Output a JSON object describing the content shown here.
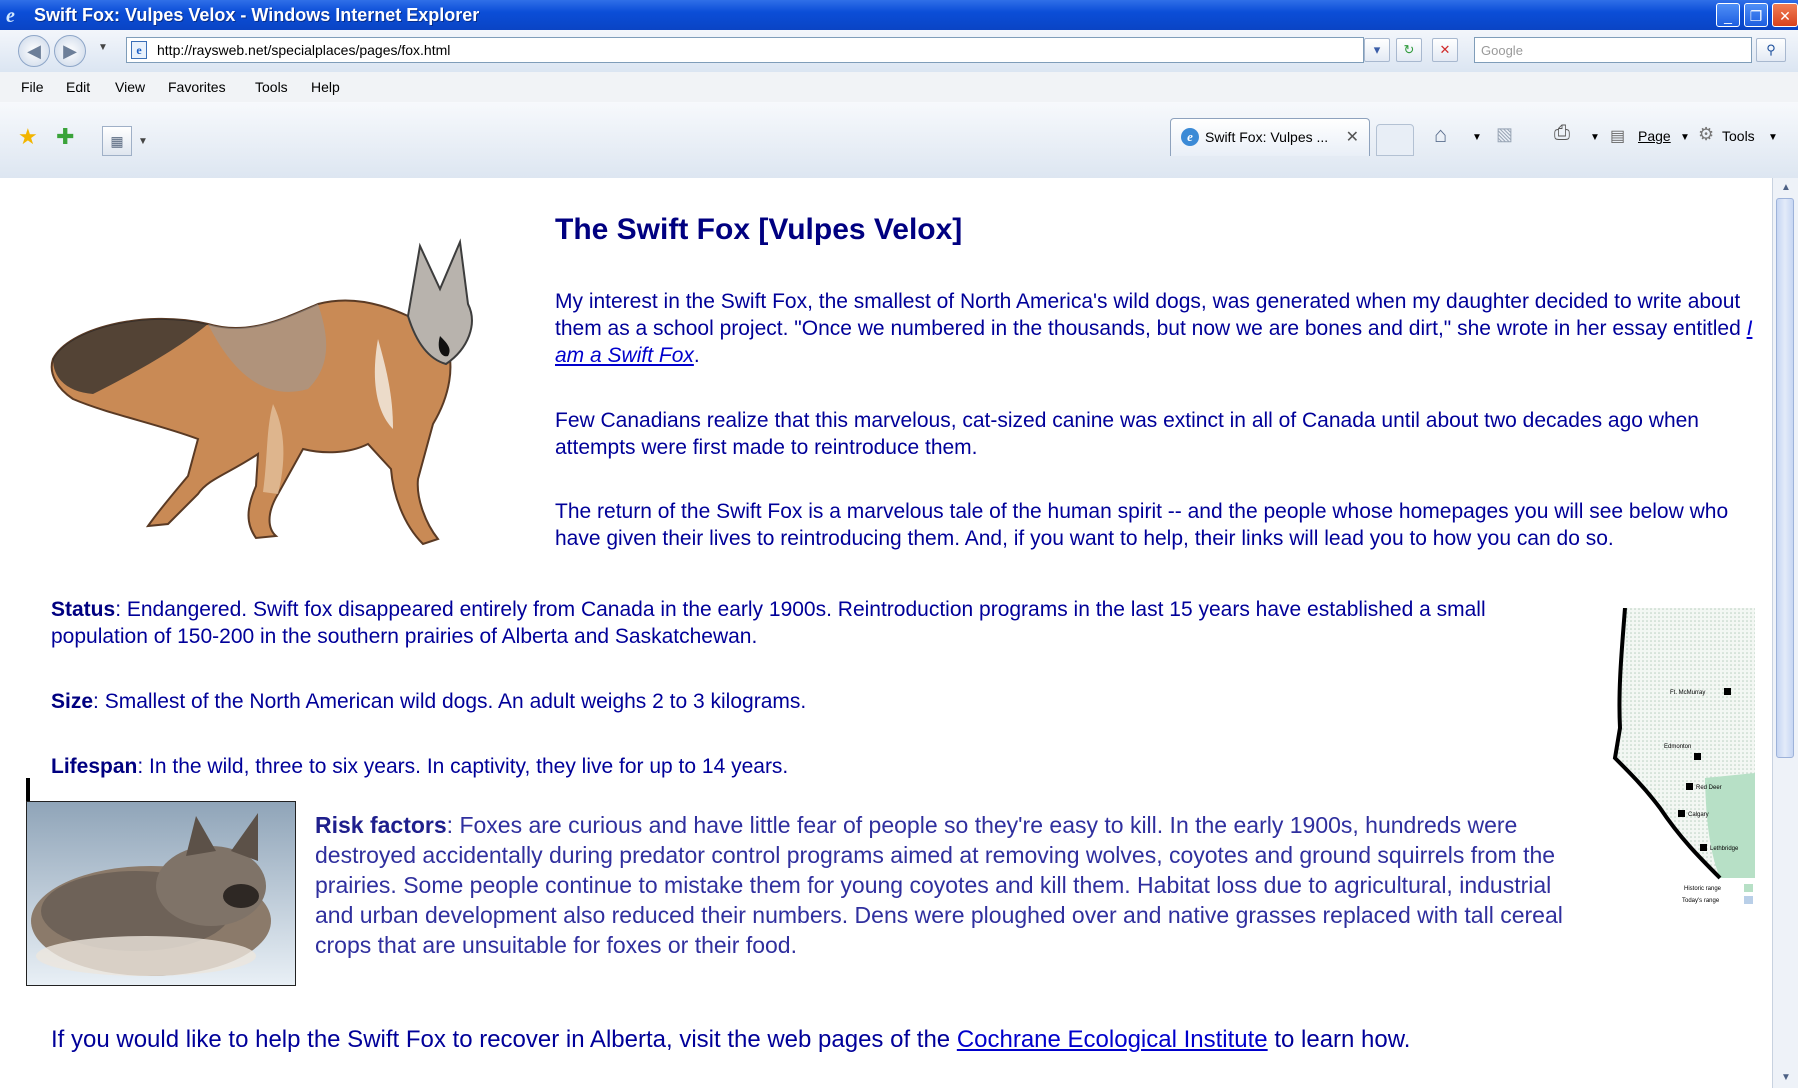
{
  "window": {
    "title": "Swift Fox: Vulpes Velox - Windows Internet Explorer"
  },
  "address_bar": {
    "url": "http://raysweb.net/specialplaces/pages/fox.html",
    "search_placeholder": "Google"
  },
  "menu": {
    "items": [
      "File",
      "Edit",
      "View",
      "Favorites",
      "Tools",
      "Help"
    ]
  },
  "command_bar": {
    "tab_label": "Swift Fox: Vulpes ...",
    "page_label": "Page",
    "tools_label": "Tools"
  },
  "page": {
    "heading": "The Swift Fox [Vulpes Velox]",
    "intro_1": "My interest in the Swift Fox, the smallest of North America's wild dogs, was generated when my daughter decided to write about them as a school project. \"Once we numbered in the thousands, but now we are bones and dirt,\" she wrote in her essay entitled ",
    "essay_link": "I am a Swift Fox",
    "intro_1_end": ".",
    "intro_2": "Few Canadians realize that this marvelous, cat-sized canine was extinct in all of Canada until about two decades ago when attempts were first made to reintroduce them.",
    "intro_3": "The return of the Swift Fox is a marvelous tale of the human spirit -- and the people whose homepages you will see below who have given their lives to reintroducing them. And, if you want to help, their links will lead you to how you can do so.",
    "status_label": "Status",
    "status_text": ": Endangered. Swift fox disappeared entirely from Canada in the early 1900s. Reintroduction programs in the last 15 years have established a small population of 150-200 in the southern prairies of Alberta and Saskatchewan.",
    "size_label": "Size",
    "size_text": ": Smallest of the North American wild dogs. An adult weighs 2 to 3 kilograms.",
    "lifespan_label": "Lifespan",
    "lifespan_text": ": In the wild, three to six years. In captivity, they live for up to 14 years.",
    "risk_label": "Risk factors",
    "risk_text": ": Foxes are curious and have little fear of people so they're easy to kill. In the early 1900s, hundreds were destroyed accidentally during predator control programs aimed at removing wolves, coyotes and ground squirrels from the prairies. Some people continue to mistake them for young coyotes and kill them. Habitat loss due to agricultural, industrial and urban development also reduced their numbers. Dens were ploughed over and native grasses replaced with tall cereal crops that are unsuitable for foxes or their food.",
    "help_text_1": "If you would like to help the Swift Fox to recover in Alberta, visit the web pages of the ",
    "help_link": "Cochrane Ecological Institute",
    "help_text_2": " to learn how."
  },
  "map": {
    "cities": [
      "Ft. McMurray",
      "Edmonton",
      "Red Deer",
      "Calgary",
      "Lethbridge"
    ],
    "legend_historic": "Historic range",
    "legend_today": "Today's range",
    "historic_color": "#b7e0c6",
    "today_color": "#b9cfe8"
  },
  "icons": {
    "back": "back-arrow-icon",
    "forward": "forward-arrow-icon",
    "refresh": "refresh-icon",
    "stop": "stop-icon",
    "search": "search-icon",
    "home": "home-icon",
    "feeds": "rss-icon",
    "print": "print-icon"
  }
}
